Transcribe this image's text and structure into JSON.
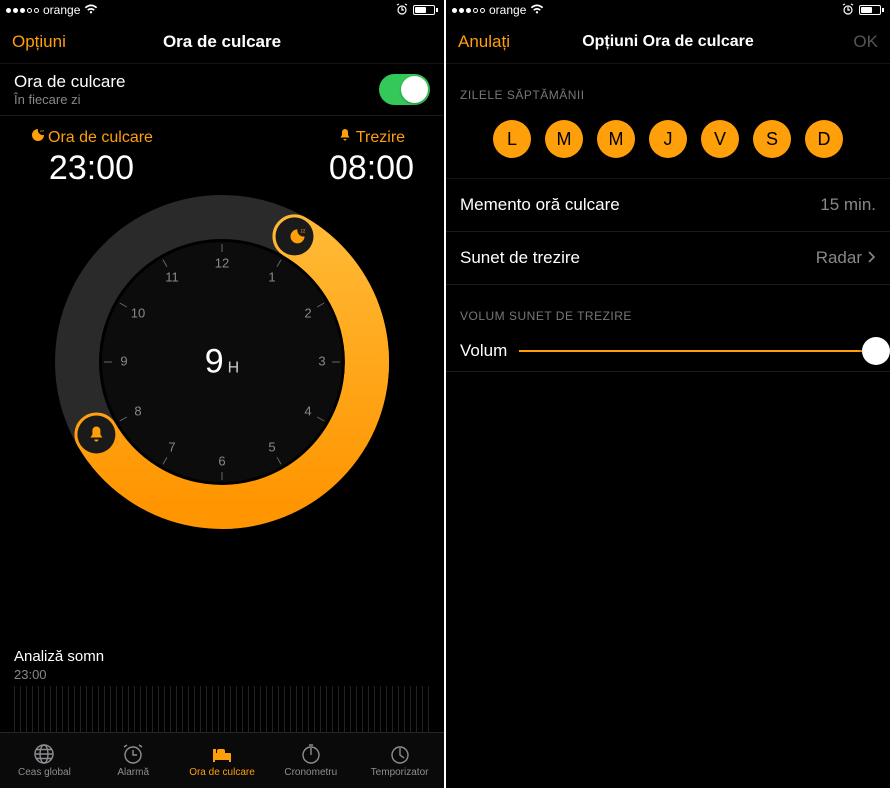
{
  "status": {
    "carrier": "orange"
  },
  "left": {
    "nav_options": "Opțiuni",
    "nav_title": "Ora de culcare",
    "bedtime_row": {
      "title": "Ora de culcare",
      "subtitle": "În fiecare zi"
    },
    "bedtime_label": "Ora de culcare",
    "wake_label": "Trezire",
    "bedtime_time": "23:00",
    "wake_time": "08:00",
    "duration": "9",
    "duration_unit": "H",
    "analysis_title": "Analiză somn",
    "analysis_start": "23:00",
    "tabs": {
      "world": "Ceas global",
      "alarm": "Alarmă",
      "bedtime": "Ora de culcare",
      "stopwatch": "Cronometru",
      "timer": "Temporizator"
    },
    "dial_hours": [
      "12",
      "1",
      "2",
      "3",
      "4",
      "5",
      "6",
      "7",
      "8",
      "9",
      "10",
      "11"
    ]
  },
  "right": {
    "nav_cancel": "Anulați",
    "nav_title": "Opțiuni Ora de culcare",
    "nav_ok": "OK",
    "days_header": "ZILELE SĂPTĂMÂNII",
    "days": [
      "L",
      "M",
      "M",
      "J",
      "V",
      "S",
      "D"
    ],
    "reminder_label": "Memento oră culcare",
    "reminder_value": "15 min.",
    "sound_label": "Sunet de trezire",
    "sound_value": "Radar",
    "volume_header": "VOLUM SUNET DE TREZIRE",
    "volume_label": "Volum"
  }
}
